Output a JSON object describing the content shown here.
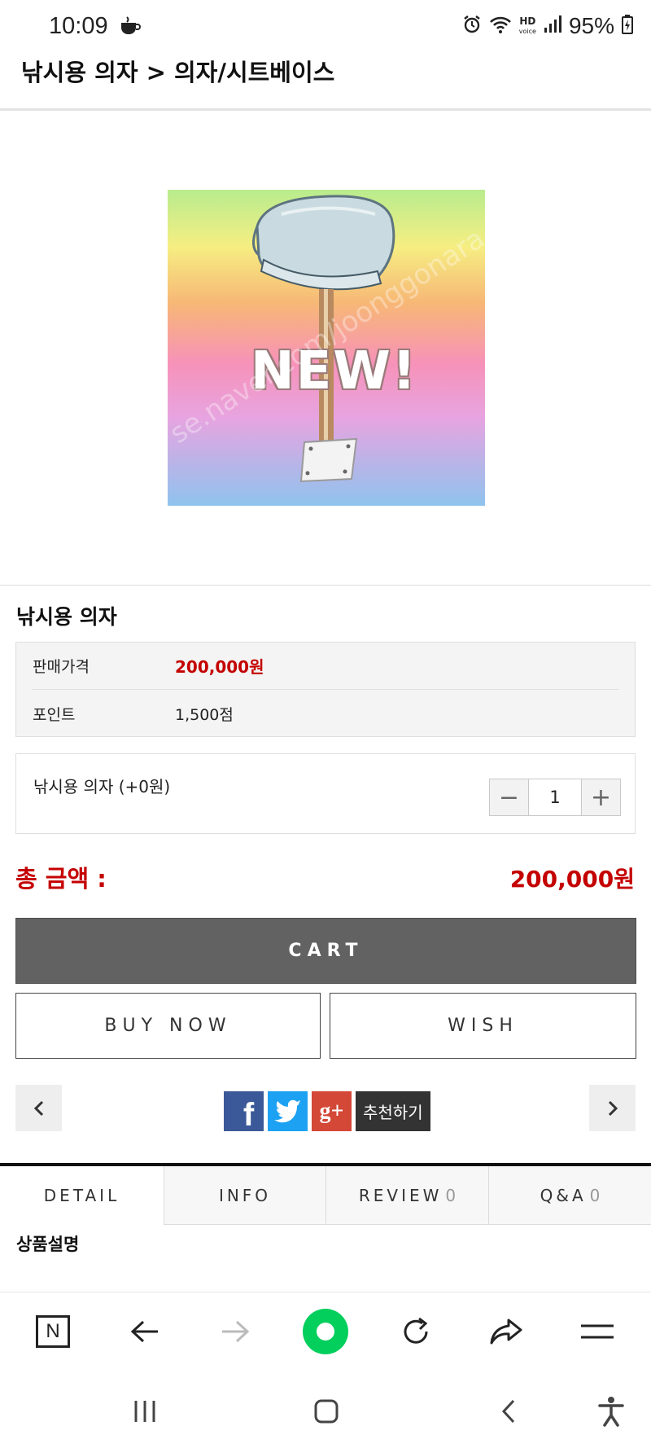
{
  "status_bar": {
    "time": "10:09",
    "hd_label": "HD",
    "voice_label": "voice",
    "battery": "95%"
  },
  "breadcrumb": "낚시용 의자 > 의자/시트베이스",
  "product_image": {
    "badge_text": "NEW!",
    "watermark": "se.naver.com/joonggonara"
  },
  "product": {
    "name": "낚시용 의자",
    "price_label": "판매가격",
    "price_value": "200,000원",
    "point_label": "포인트",
    "point_value": "1,500점"
  },
  "option": {
    "label": "낚시용 의자 (+0원)",
    "quantity": "1",
    "minus": "−",
    "plus": "+"
  },
  "total": {
    "label": "총 금액 :",
    "value": "200,000원"
  },
  "buttons": {
    "cart": "CART",
    "buy_now": "BUY NOW",
    "wish": "WISH"
  },
  "share": {
    "recommend": "추천하기",
    "facebook_letter": "f",
    "google_label": "g+"
  },
  "tabs": [
    {
      "label": "DETAIL",
      "count": ""
    },
    {
      "label": "INFO",
      "count": ""
    },
    {
      "label": "REVIEW",
      "count": "0"
    },
    {
      "label": "Q&A",
      "count": "0"
    }
  ],
  "section_title": "상품설명",
  "browser": {
    "home_letter": "N"
  },
  "colors": {
    "price_red": "#c40000",
    "cart_bg": "#626262",
    "facebook": "#3b5998",
    "twitter": "#1da1f2",
    "google_plus": "#d34836",
    "naver_green": "#03cf5d"
  }
}
